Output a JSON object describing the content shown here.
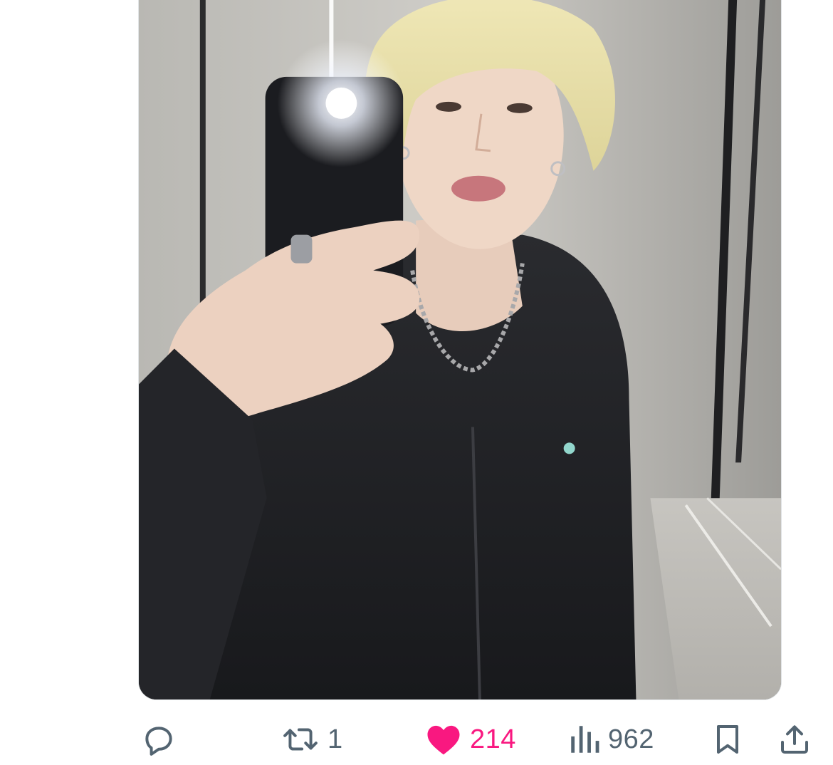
{
  "media": {
    "alt_description": "",
    "icon": "photo"
  },
  "actions": {
    "reply": {
      "icon": "reply-icon",
      "count": ""
    },
    "repost": {
      "icon": "repost-icon",
      "count": "1"
    },
    "like": {
      "icon": "heart-icon",
      "count": "214",
      "liked": true,
      "color": "#f91880"
    },
    "views": {
      "icon": "views-chart-icon",
      "count": "962"
    },
    "bookmark": {
      "icon": "bookmark-icon"
    },
    "share": {
      "icon": "share-icon"
    }
  },
  "colors": {
    "icon_gray": "#536471",
    "like_pink": "#f91880",
    "card_border": "#e1e4e6"
  }
}
